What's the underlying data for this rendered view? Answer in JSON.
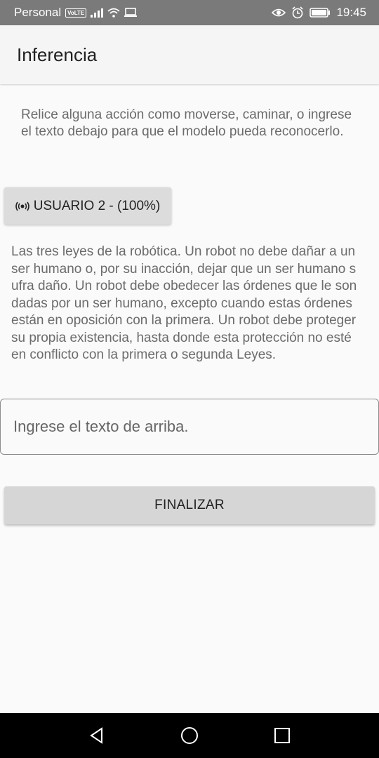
{
  "status_bar": {
    "carrier": "Personal",
    "volte": "VoLTE",
    "time": "19:45",
    "icons": [
      "signal-icon",
      "wifi-icon",
      "cast-icon",
      "eye-icon",
      "alarm-icon",
      "battery-icon"
    ]
  },
  "app_bar": {
    "title": "Inferencia"
  },
  "instructions": "Relice alguna acción como moverse, caminar, o ingrese el texto debajo para que el modelo pueda reconocerlo.",
  "user_chip": {
    "icon": "broadcast-icon",
    "label": "USUARIO 2 - (100%)"
  },
  "law_text": "Las tres leyes de la robótica. Un robot no debe dañar a un ser humano o, por su inacción, dejar que un ser humano sufra daño. Un robot debe obedecer las órdenes que le son dadas por un ser humano, excepto cuando estas órdenes están en oposición con la primera. Un robot debe proteger su propia existencia, hasta donde esta protección no esté en conflicto con la primera o segunda Leyes.",
  "input": {
    "placeholder": "Ingrese el texto de arriba.",
    "value": ""
  },
  "finish_button": {
    "label": "FINALIZAR"
  },
  "nav_bar": {
    "icons": [
      "back-icon",
      "home-icon",
      "recents-icon"
    ]
  }
}
